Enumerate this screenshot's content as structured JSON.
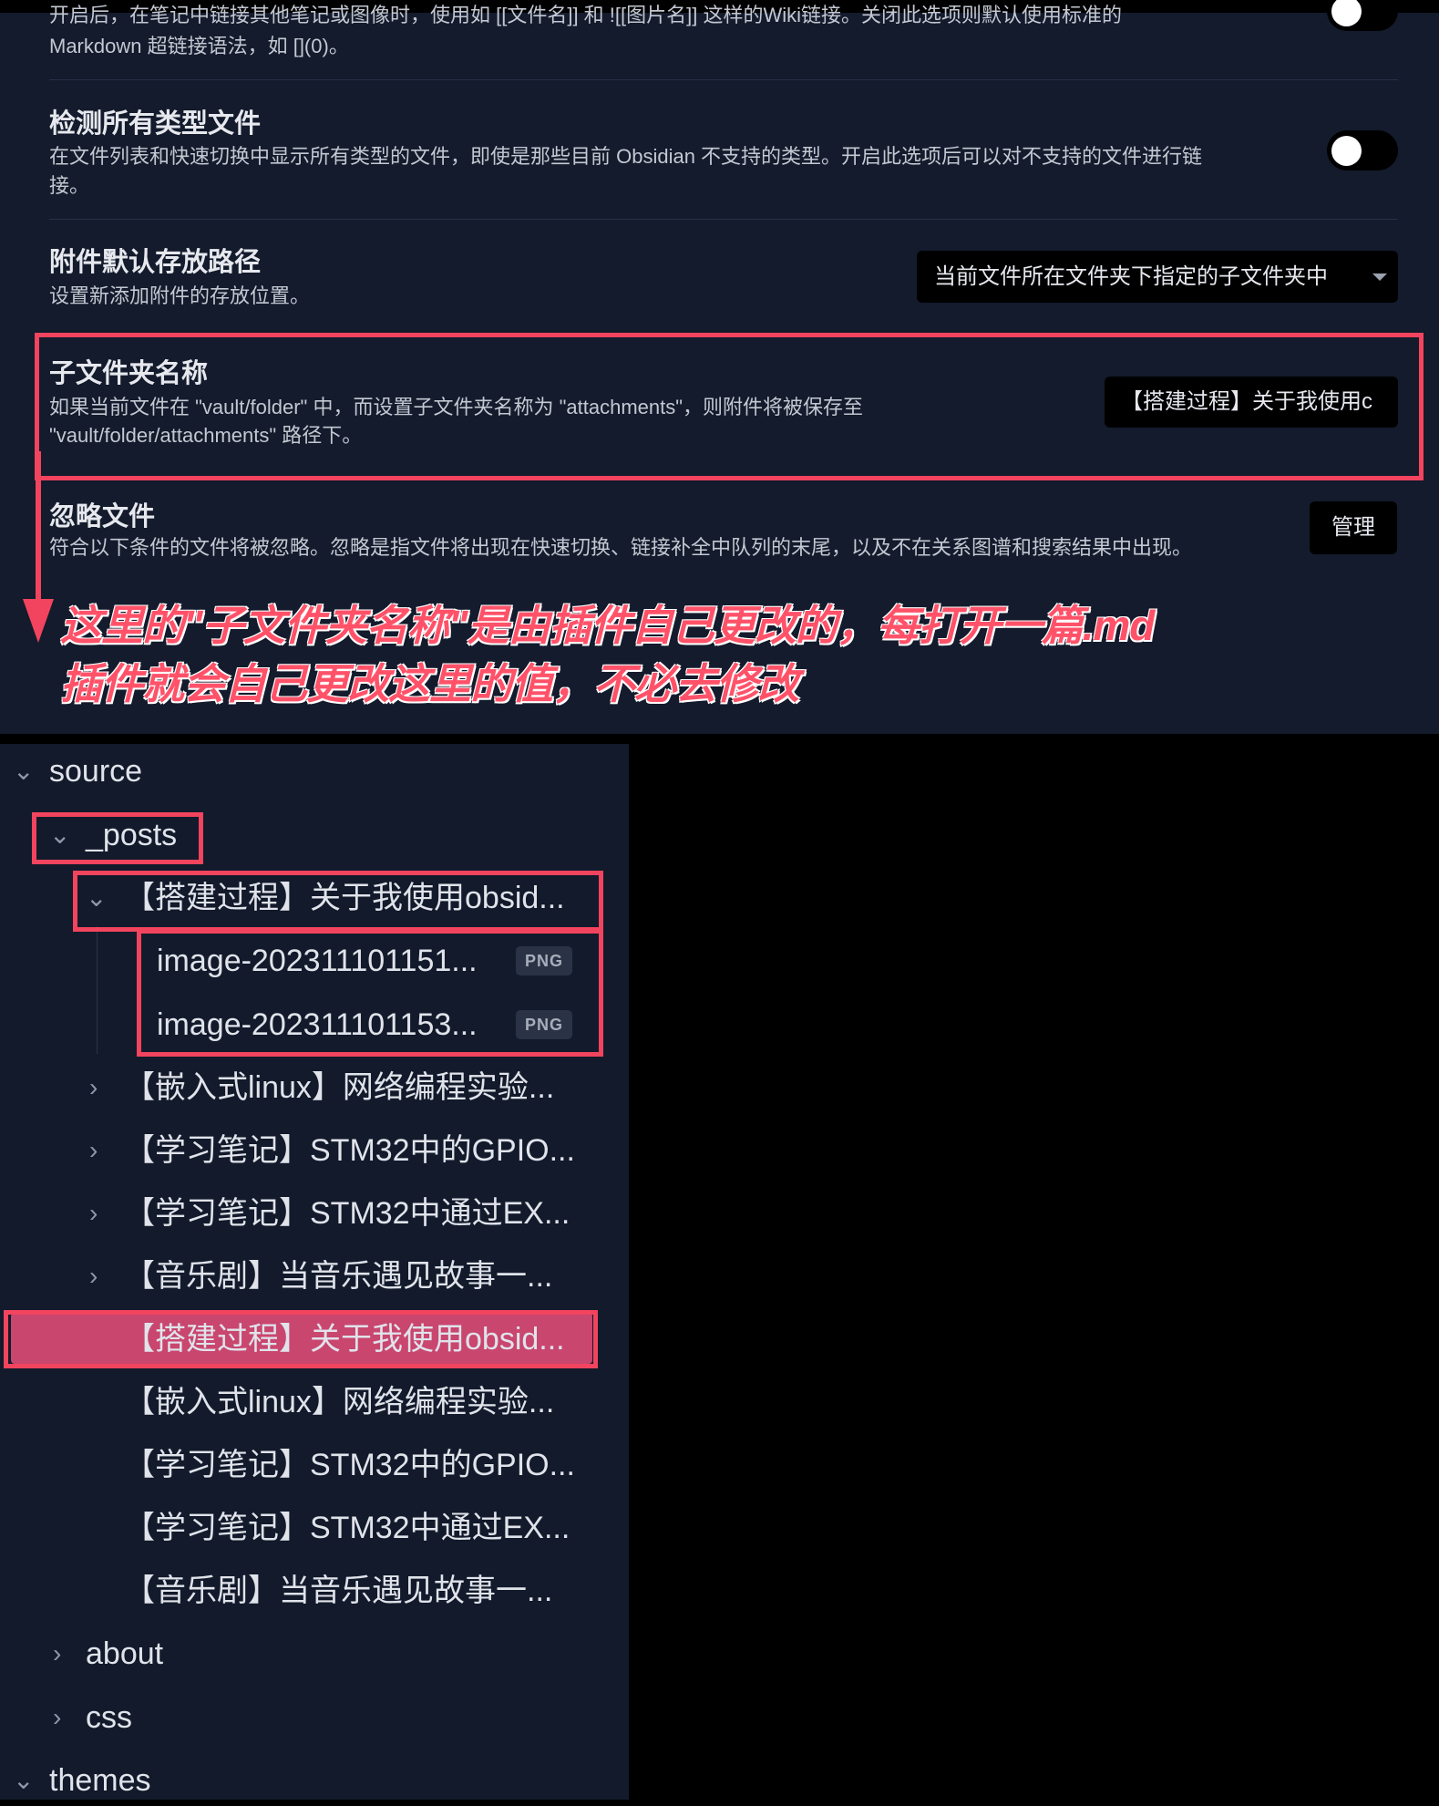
{
  "settings": {
    "partial_top_line": "开启后，在笔记中链接其他笔记或图像时，使用如 [[文件名]] 和 ![[图片名]] 这样的Wiki链接。关闭此选项则默认使用标准的",
    "partial_second_line": "Markdown 超链接语法，如 [](0)。",
    "detect_all_files": {
      "label": "检测所有类型文件",
      "desc_line1": "在文件列表和快速切换中显示所有类型的文件，即使是那些目前 Obsidian 不支持的类型。开启此选项后可以对不支持的文件进行链",
      "desc_line2": "接。",
      "enabled": false
    },
    "attachment_path": {
      "label": "附件默认存放路径",
      "desc": "设置新添加附件的存放位置。",
      "selected": "当前文件所在文件夹下指定的子文件夹中"
    },
    "subfolder_name": {
      "label": "子文件夹名称",
      "desc_line1": "如果当前文件在 \"vault/folder\" 中，而设置子文件夹名称为 \"attachments\"，则附件将被保存至",
      "desc_line2": "\"vault/folder/attachments\" 路径下。",
      "value": "【搭建过程】关于我使用c"
    },
    "ignore_files": {
      "label": "忽略文件",
      "desc": "符合以下条件的文件将被忽略。忽略是指文件将出现在快速切换、链接补全中队列的末尾，以及不在关系图谱和搜索结果中出现。",
      "button": "管理"
    }
  },
  "annotation": {
    "line1": "这里的\"子文件夹名称\"是由插件自己更改的，每打开一篇.md",
    "line2": "插件就会自己更改这里的值，不必去修改",
    "color": "#ff5269"
  },
  "tree": {
    "source": "source",
    "posts": "_posts",
    "open_folder": "【搭建过程】关于我使用obsid...",
    "files": [
      {
        "name": "image-202311101151...",
        "ext": "PNG"
      },
      {
        "name": "image-202311101153...",
        "ext": "PNG"
      }
    ],
    "collapsed_folders": [
      "【嵌入式linux】网络编程实验...",
      "【学习笔记】STM32中的GPIO...",
      "【学习笔记】STM32中通过EX...",
      "【音乐剧】当音乐遇见故事一..."
    ],
    "md_files": [
      "【搭建过程】关于我使用obsid...",
      "【嵌入式linux】网络编程实验...",
      "【学习笔记】STM32中的GPIO...",
      "【学习笔记】STM32中通过EX...",
      "【音乐剧】当音乐遇见故事一..."
    ],
    "about": "about",
    "css": "css",
    "themes": "themes",
    "active_color": "#c9466f"
  },
  "icons": {
    "expanded": "chevron-down-icon",
    "collapsed": "chevron-right-icon"
  }
}
